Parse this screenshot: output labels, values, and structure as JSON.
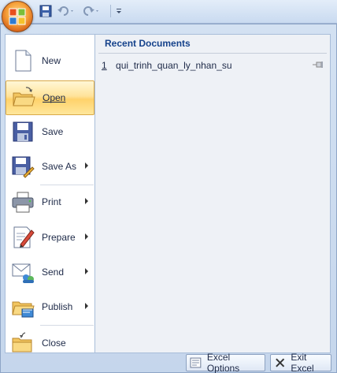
{
  "menu": {
    "items": [
      {
        "label": "New",
        "has_arrow": false
      },
      {
        "label": "Open",
        "has_arrow": false
      },
      {
        "label": "Save",
        "has_arrow": false
      },
      {
        "label": "Save As",
        "has_arrow": true
      },
      {
        "label": "Print",
        "has_arrow": true
      },
      {
        "label": "Prepare",
        "has_arrow": true
      },
      {
        "label": "Send",
        "has_arrow": true
      },
      {
        "label": "Publish",
        "has_arrow": true
      },
      {
        "label": "Close",
        "has_arrow": false
      }
    ]
  },
  "recent": {
    "header": "Recent Documents",
    "items": [
      {
        "number": "1",
        "name": "qui_trinh_quan_ly_nhan_su"
      }
    ]
  },
  "footer": {
    "options_label": "Excel Options",
    "exit_label": "Exit Excel"
  },
  "icons": {
    "office_button": "office-logo-icon",
    "qat_save": "save-icon",
    "qat_undo": "undo-icon",
    "qat_redo": "redo-icon",
    "qat_customize": "customize-arrow-icon"
  },
  "colors": {
    "accent_highlight": "#ffd26b",
    "header_text": "#15428b"
  }
}
